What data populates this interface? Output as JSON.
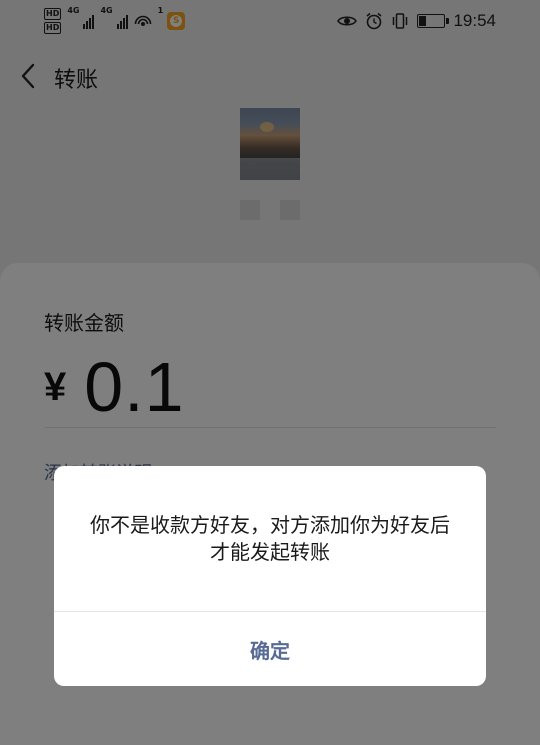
{
  "status_bar": {
    "hd_labels": [
      "HD",
      "HD"
    ],
    "network_labels": [
      "4G",
      "4G"
    ],
    "hotspot_count": "1",
    "app_icon_letter": "S",
    "icons": [
      "eye-icon",
      "alarm-icon",
      "vibrate-icon",
      "battery-icon"
    ],
    "time": "19:54"
  },
  "nav": {
    "back_icon": "chevron-left-icon",
    "title": "转账"
  },
  "recipient": {
    "avatar": "photo"
  },
  "transfer": {
    "amount_label": "转账金额",
    "currency_symbol": "¥",
    "amount": "0.1",
    "note_link_partial": "添加转账说明"
  },
  "dialog": {
    "message": "你不是收款方好友，对方添加你为好友后才能发起转账",
    "confirm_label": "确定"
  },
  "colors": {
    "link": "#576b95",
    "mask": "rgba(0,0,0,0.5)"
  }
}
